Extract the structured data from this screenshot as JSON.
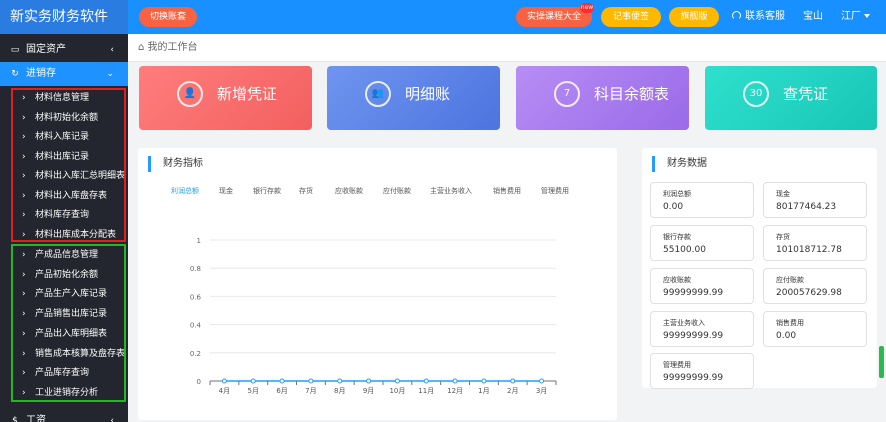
{
  "app": {
    "title": "新实务财务软件",
    "switch_label": "切换账套"
  },
  "topbar": {
    "course_label": "实操课程大全",
    "course_badge": "new",
    "note_label": "记事便签",
    "flag_label": "旗舰版",
    "service_label": "联系客服",
    "user_label": "宝山",
    "company_label": "江厂"
  },
  "sidebar": {
    "fixed_assets": "固定资产",
    "inventory": "进销存",
    "material_items": [
      "材料信息管理",
      "材料初始化余额",
      "材料入库记录",
      "材料出库记录",
      "材料出入库汇总明细表",
      "材料出入库盘存表",
      "材料库存查询",
      "材料出库成本分配表"
    ],
    "product_items": [
      "产成品信息管理",
      "产品初始化余额",
      "产品生产入库记录",
      "产品销售出库记录",
      "产品出入库明细表",
      "销售成本核算及盘存表",
      "产品库存查询",
      "工业进销存分析"
    ],
    "wages": "工资"
  },
  "breadcrumb": "我的工作台",
  "cards": [
    {
      "label": "新增凭证",
      "icon": "user-plus-icon",
      "color": "#f2605f"
    },
    {
      "label": "明细账",
      "icon": "people-icon",
      "color": "#4d74df"
    },
    {
      "label": "科目余额表",
      "icon": "7",
      "color": "#9a6ae8"
    },
    {
      "label": "查凭证",
      "icon": "30",
      "color": "#19c6b6"
    }
  ],
  "indicators": {
    "title": "财务指标",
    "tabs": [
      "利润总额",
      "现金",
      "银行存款",
      "存货",
      "应收账款",
      "应付账款",
      "主营业务收入",
      "销售费用",
      "管理费用"
    ],
    "active_tab": "利润总额"
  },
  "chart_data": {
    "type": "line",
    "categories": [
      "4月",
      "5月",
      "6月",
      "7月",
      "8月",
      "9月",
      "10月",
      "11月",
      "12月",
      "1月",
      "2月",
      "3月"
    ],
    "series": [
      {
        "values": [
          0,
          0,
          0,
          0,
          0,
          0,
          0,
          0,
          0,
          0,
          0,
          0
        ]
      }
    ],
    "yticks": [
      "0",
      "0.2",
      "0.4",
      "0.6",
      "0.8",
      "1"
    ],
    "ylim": [
      0,
      1
    ],
    "grid": true,
    "line_color": "#1e9fff"
  },
  "findata": {
    "title": "财务数据",
    "items": [
      {
        "label": "利润总额",
        "value": "0.00"
      },
      {
        "label": "现金",
        "value": "80177464.23"
      },
      {
        "label": "银行存款",
        "value": "55100.00"
      },
      {
        "label": "存货",
        "value": "101018712.78"
      },
      {
        "label": "应收账款",
        "value": "99999999.99"
      },
      {
        "label": "应付账款",
        "value": "200057629.98"
      },
      {
        "label": "主营业务收入",
        "value": "99999999.99"
      },
      {
        "label": "销售费用",
        "value": "0.00"
      },
      {
        "label": "管理费用",
        "value": "99999999.99"
      }
    ]
  }
}
